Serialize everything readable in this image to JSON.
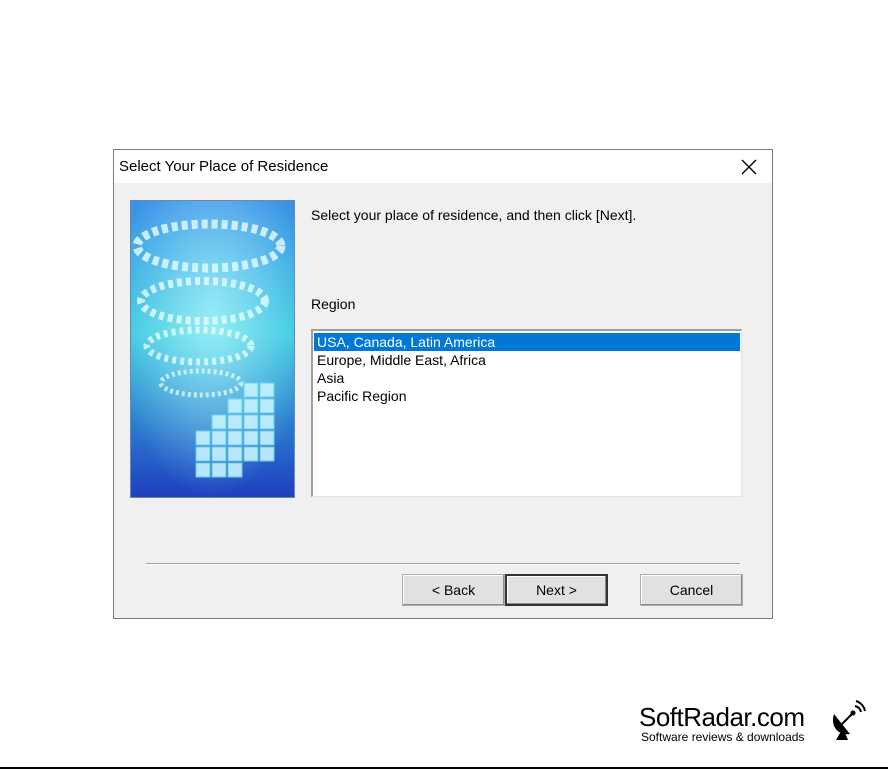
{
  "dialog": {
    "title": "Select Your Place of Residence",
    "close_icon": "close-icon",
    "instruction": "Select your place of residence, and then click [Next].",
    "region_label": "Region",
    "regions": [
      {
        "label": "USA, Canada, Latin America",
        "selected": true
      },
      {
        "label": "Europe, Middle East, Africa",
        "selected": false
      },
      {
        "label": "Asia",
        "selected": false
      },
      {
        "label": "Pacific Region",
        "selected": false
      }
    ],
    "buttons": {
      "back": "< Back",
      "next": "Next >",
      "cancel": "Cancel"
    }
  },
  "colors": {
    "selection": "#0078d7",
    "dialog_bg": "#f0f0f0"
  },
  "watermark": {
    "name": "SoftRadar.com",
    "tagline": "Software reviews & downloads",
    "icon": "satellite-dish-icon"
  }
}
